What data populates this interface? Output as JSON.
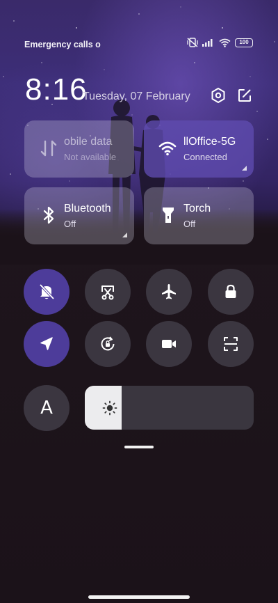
{
  "status_bar": {
    "carrier_text": "Emergency calls o",
    "battery_level": "100",
    "icons": [
      "vibrate-off-icon",
      "signal-icon",
      "wifi-icon",
      "battery-icon"
    ]
  },
  "header": {
    "time": "8:16",
    "date": "Tuesday, 07 February",
    "settings_icon": "settings-hexagon-icon",
    "edit_icon": "edit-icon"
  },
  "tiles": {
    "mobile_data": {
      "title": "obile data",
      "subtitle": "Not available",
      "icon": "mobile-data-icon",
      "state": "disabled"
    },
    "wifi": {
      "title": "llOffice-5G",
      "subtitle": "Connected",
      "icon": "wifi-icon",
      "state": "on"
    },
    "bluetooth": {
      "title": "Bluetooth",
      "subtitle": "Off",
      "icon": "bluetooth-icon",
      "state": "off"
    },
    "torch": {
      "title": "Torch",
      "subtitle": "Off",
      "icon": "torch-icon",
      "state": "off"
    }
  },
  "toggles_row1": [
    {
      "name": "silent",
      "icon": "bell-off-icon",
      "on": true
    },
    {
      "name": "screenshot",
      "icon": "screenshot-scissors-icon",
      "on": false
    },
    {
      "name": "airplane",
      "icon": "airplane-icon",
      "on": false
    },
    {
      "name": "lock",
      "icon": "lock-icon",
      "on": false
    }
  ],
  "toggles_row2": [
    {
      "name": "location",
      "icon": "location-arrow-icon",
      "on": true
    },
    {
      "name": "rotation-lock",
      "icon": "rotation-lock-icon",
      "on": false
    },
    {
      "name": "screen-recorder",
      "icon": "video-camera-icon",
      "on": false
    },
    {
      "name": "scanner",
      "icon": "scan-icon",
      "on": false
    }
  ],
  "font_button": {
    "label": "A"
  },
  "brightness": {
    "level": 0.22,
    "icon": "sun-icon"
  },
  "colors": {
    "accent": "#4d3c9a",
    "tile_active": "#5f4baf",
    "button_bg": "#3b3640"
  }
}
